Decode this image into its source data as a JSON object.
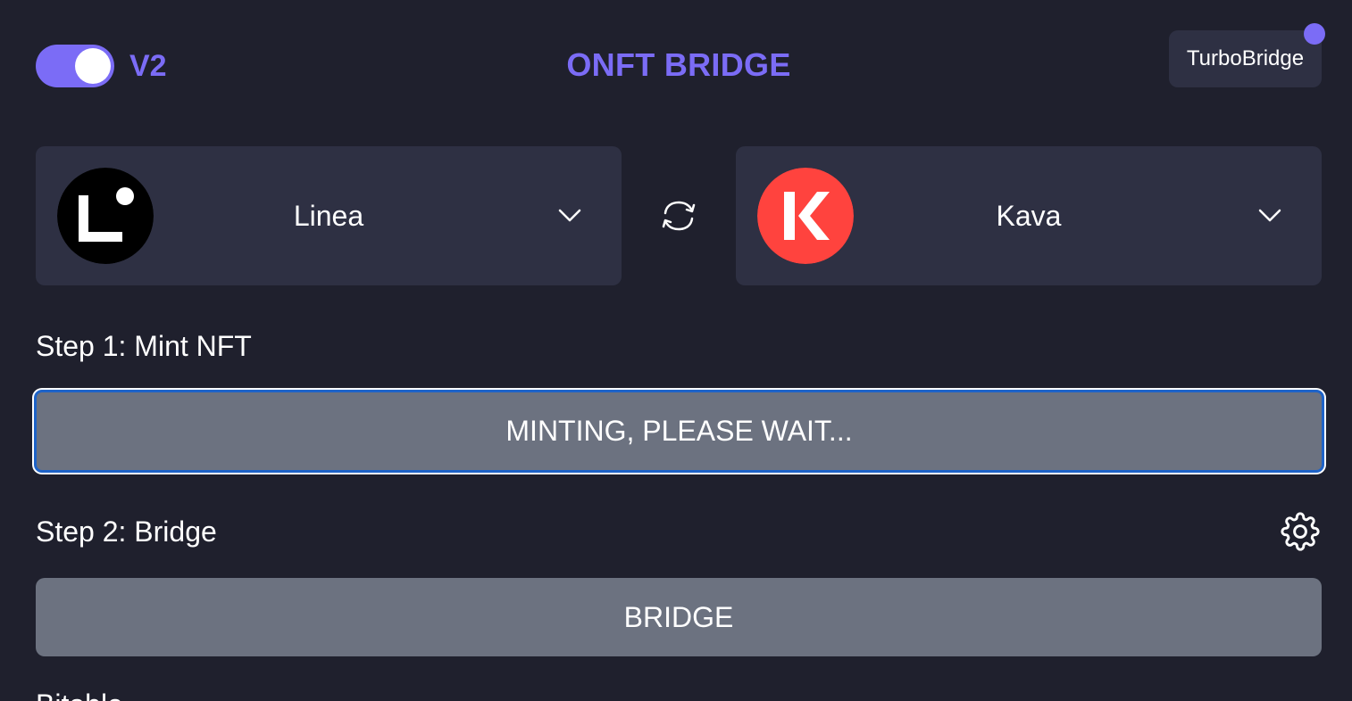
{
  "header": {
    "version_label": "V2",
    "title": "ONFT BRIDGE",
    "turbo_button_label": "TurboBridge",
    "accent_color": "#7b6cf6",
    "toggle_on": true
  },
  "chains": {
    "source": {
      "name": "Linea",
      "icon": "linea-logo"
    },
    "destination": {
      "name": "Kava",
      "icon": "kava-logo"
    },
    "swap_icon": "swap-arrows-icon"
  },
  "step1": {
    "label": "Step 1: Mint NFT",
    "button_label": "MINTING, PLEASE WAIT..."
  },
  "step2": {
    "label": "Step 2: Bridge",
    "settings_icon": "gear-icon",
    "button_label": "BRIDGE"
  },
  "footer": {
    "cutoff_text": "Bitable"
  }
}
